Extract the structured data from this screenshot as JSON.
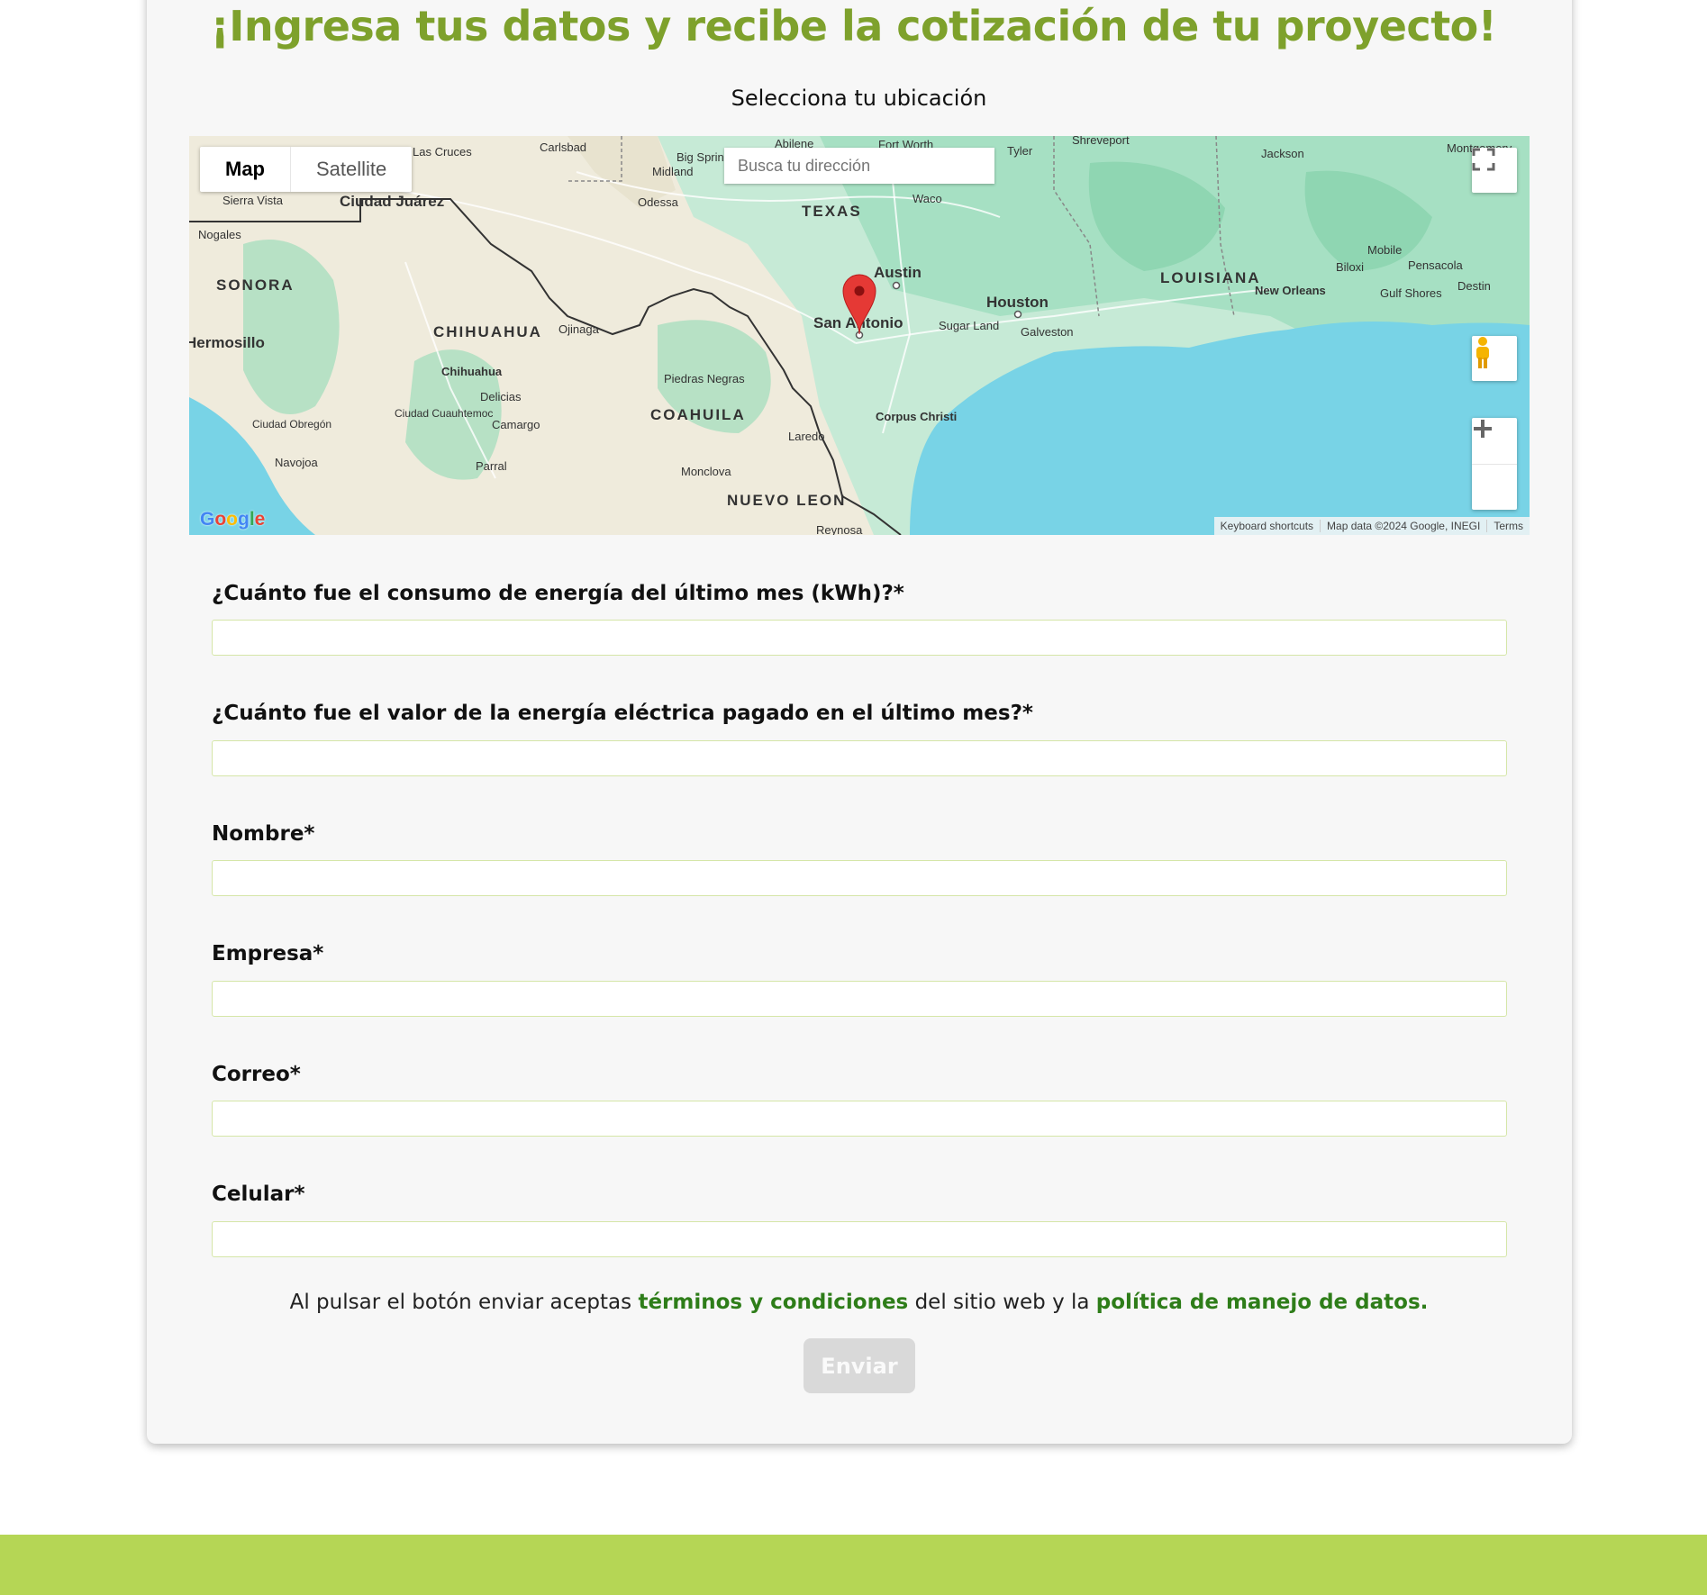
{
  "page": {
    "title": "¡Ingresa tus datos y recibe la cotización de tu proyecto!",
    "subtitle": "Selecciona tu ubicación"
  },
  "map": {
    "type_map": "Map",
    "type_satellite": "Satellite",
    "search_placeholder": "Busca tu dirección",
    "attribution": {
      "shortcuts": "Keyboard shortcuts",
      "data": "Map data ©2024 Google, INEGI",
      "terms": "Terms"
    },
    "logo": "Google",
    "marker_location": "San Antonio",
    "labels": {
      "texas": "TEXAS",
      "louisiana": "LOUISIANA",
      "sonora": "SONORA",
      "chihuahua_state": "CHIHUAHUA",
      "coahuila": "COAHUILA",
      "nuevo_leon": "NUEVO LEON",
      "austin": "Austin",
      "houston": "Houston",
      "san_antonio": "San Antonio",
      "waco": "Waco",
      "dallas": "Fort Worth",
      "shreveport": "Shreveport",
      "jackson": "Jackson",
      "mobile": "Mobile",
      "pensacola": "Pensacola",
      "biloxi": "Biloxi",
      "new_orleans": "New Orleans",
      "gulf_shores": "Gulf Shores",
      "destin": "Destin",
      "galveston": "Galveston",
      "sugar_land": "Sugar Land",
      "corpus": "Corpus Christi",
      "laredo": "Laredo",
      "reynosa": "Reynosa",
      "monclova": "Monclova",
      "piedras": "Piedras Negras",
      "ojinaga": "Ojinaga",
      "chihuahua_city": "Chihuahua",
      "delicias": "Delicias",
      "cuauhtemoc": "Ciudad\nCuauhtemoc",
      "camargo": "Camargo",
      "parral": "Parral",
      "hermosillo": "Hermosillo",
      "obregon": "Ciudad\nObregón",
      "navojoa": "Navojoa",
      "nogales": "Nogales",
      "sierra_vista": "Sierra Vista",
      "juarez": "Ciudad Juárez",
      "las_cruces": "Las Cruces",
      "carlsbad": "Carlsbad",
      "midland": "Midland",
      "odessa": "Odessa",
      "big_spring": "Big Spring",
      "abilene": "Abilene",
      "tyler": "Tyler",
      "montgomery": "Montgomery"
    }
  },
  "form": {
    "fields": [
      {
        "label": "¿Cuánto fue el consumo de energía del último mes (kWh)?*",
        "value": ""
      },
      {
        "label": "¿Cuánto fue el valor de la energía eléctrica pagado en el último mes?*",
        "value": ""
      },
      {
        "label": "Nombre*",
        "value": ""
      },
      {
        "label": "Empresa*",
        "value": ""
      },
      {
        "label": "Correo*",
        "value": ""
      },
      {
        "label": "Celular*",
        "value": ""
      }
    ],
    "terms_prefix": "Al pulsar el botón enviar aceptas ",
    "terms_link": "términos y condiciones",
    "terms_middle": " del sitio web y la ",
    "privacy_link": "política de manejo de datos.",
    "submit_label": "Enviar"
  },
  "colors": {
    "title": "#7ea12c",
    "link": "#2e7d19",
    "footer": "#b5d655",
    "input_border": "#d5e6a8",
    "button_disabled": "#d9d9d9",
    "marker": "#e53935"
  },
  "icons": {
    "fullscreen": "fullscreen-icon",
    "pegman": "pegman-icon",
    "zoom_in": "plus-icon",
    "zoom_out": "minus-icon",
    "marker": "map-pin-icon"
  }
}
